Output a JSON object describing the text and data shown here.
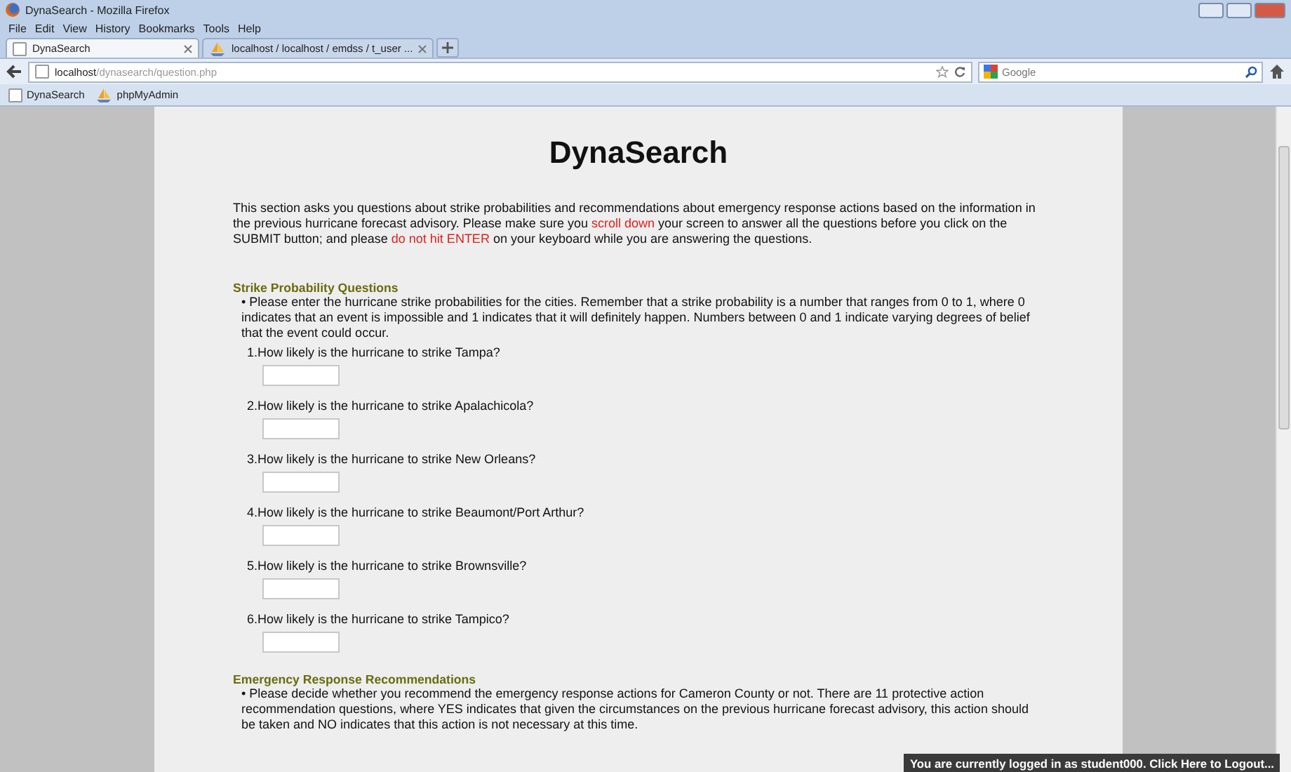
{
  "window": {
    "title": "DynaSearch - Mozilla Firefox"
  },
  "menu": [
    "File",
    "Edit",
    "View",
    "History",
    "Bookmarks",
    "Tools",
    "Help"
  ],
  "tabs": [
    {
      "label": "DynaSearch",
      "selected": true,
      "kind": "blank"
    },
    {
      "label": "localhost / localhost / emdss / t_user ...",
      "selected": false,
      "kind": "pma"
    }
  ],
  "address_bar": {
    "host": "localhost",
    "path": "/dynasearch/question.php"
  },
  "search": {
    "placeholder": "Google"
  },
  "bookmarks": [
    {
      "label": "DynaSearch",
      "kind": "blank"
    },
    {
      "label": "phpMyAdmin",
      "kind": "pma"
    }
  ],
  "page": {
    "title": "DynaSearch",
    "intro": [
      {
        "text": "This section asks you questions about strike probabilities and recommendations about emergency response actions based on the information in the previous hurricane forecast advisory. Please make sure you ",
        "kind": "normal"
      },
      {
        "text": "scroll down",
        "kind": "warning"
      },
      {
        "text": " your screen to answer all the questions before you click on the SUBMIT button; and please ",
        "kind": "normal"
      },
      {
        "text": "do not hit ENTER",
        "kind": "warning"
      },
      {
        "text": " on your keyboard while you are answering the questions.",
        "kind": "normal"
      }
    ],
    "sections": [
      {
        "heading": "Strike Probability Questions",
        "text": "• Please enter the hurricane strike probabilities for the cities. Remember that a strike probability is a number that ranges from 0 to 1, where 0 indicates that an event is impossible and 1 indicates that it will definitely happen. Numbers between 0 and 1 indicate varying degrees of belief that the event could occur.",
        "questions": [
          "1.How likely is the hurricane to strike Tampa?",
          "2.How likely is the hurricane to strike Apalachicola?",
          "3.How likely is the hurricane to strike New Orleans?",
          "4.How likely is the hurricane to strike Beaumont/Port Arthur?",
          "5.How likely is the hurricane to strike Brownsville?",
          "6.How likely is the hurricane to strike Tampico?"
        ]
      },
      {
        "heading": "Emergency Response Recommendations",
        "text": "• Please decide whether you recommend the emergency response actions for Cameron County or not. There are 11 protective action recommendation questions, where YES indicates that given the circumstances on the previous hurricane forecast advisory, this action should be taken and NO indicates that this action is not necessary at this time."
      }
    ]
  },
  "login_bar": "You are currently logged in as student000. Click Here to Logout..."
}
